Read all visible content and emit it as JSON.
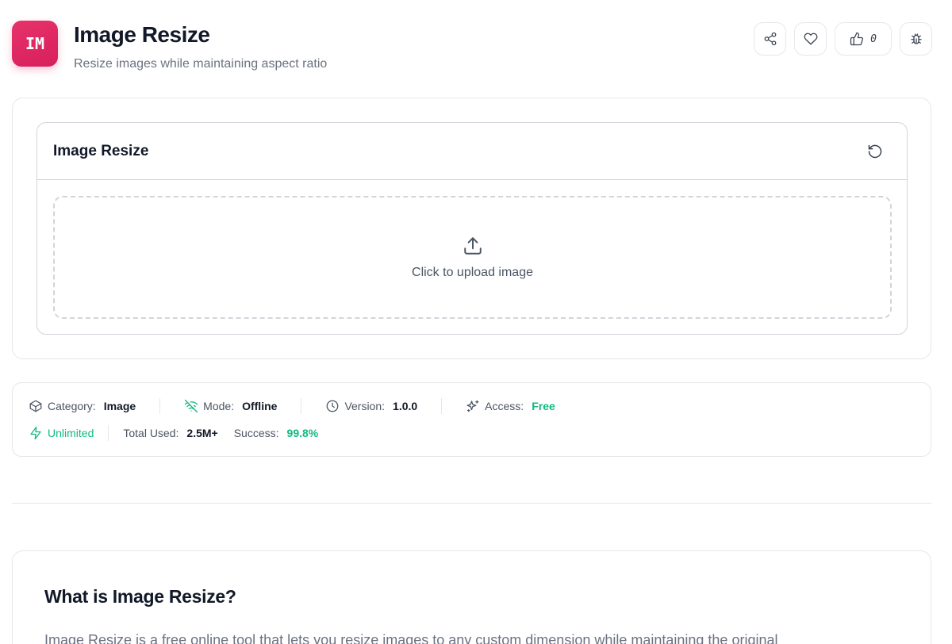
{
  "header": {
    "logo_text": "IM",
    "title": "Image Resize",
    "subtitle": "Resize images while maintaining aspect ratio",
    "actions": {
      "share_icon": "share-icon",
      "favorite_icon": "heart-icon",
      "like_icon": "thumbs-up-icon",
      "like_count": "0",
      "report_icon": "bug-icon"
    }
  },
  "tool": {
    "title": "Image Resize",
    "reset_icon": "rotate-ccw-icon",
    "dropzone_text": "Click to upload image"
  },
  "meta": {
    "category_label": "Category:",
    "category_value": "Image",
    "mode_label": "Mode:",
    "mode_value": "Offline",
    "version_label": "Version:",
    "version_value": "1.0.0",
    "access_label": "Access:",
    "access_value": "Free",
    "unlimited_label": "Unlimited",
    "total_used_label": "Total Used:",
    "total_used_value": "2.5M+",
    "success_label": "Success:",
    "success_value": "99.8%"
  },
  "about": {
    "title": "What is Image Resize?",
    "text": "Image Resize is a free online tool that lets you resize images to any custom dimension while maintaining the original"
  },
  "colors": {
    "brand": "#d61f5c",
    "success": "#10b981",
    "border": "#e5e7eb"
  }
}
